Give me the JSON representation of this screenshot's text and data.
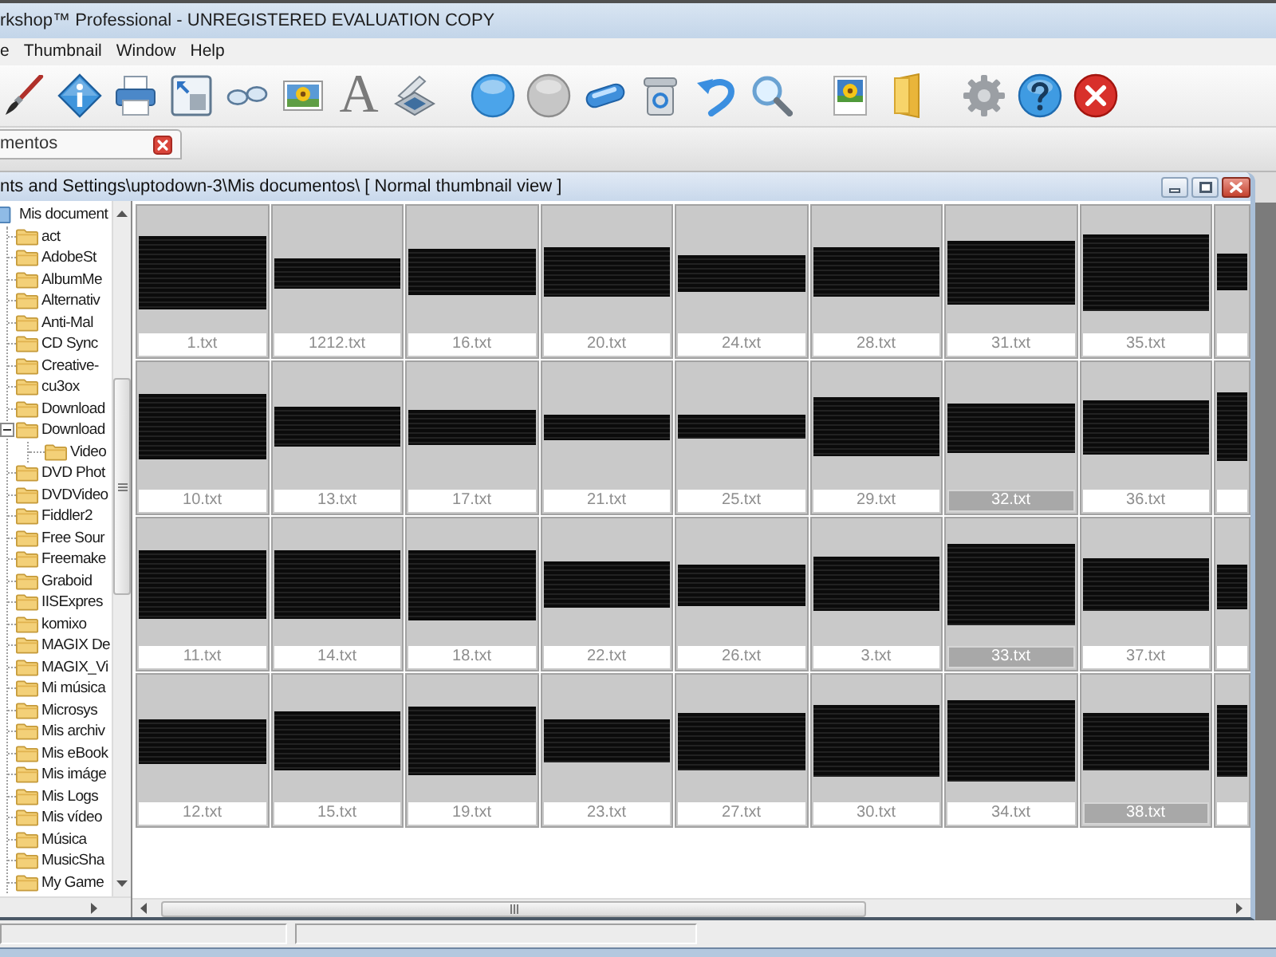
{
  "window": {
    "title": "rkshop™ Professional - UNREGISTERED EVALUATION COPY"
  },
  "menu": [
    {
      "label": "e"
    },
    {
      "label": "Thumbnail"
    },
    {
      "label": "Window"
    },
    {
      "label": "Help"
    }
  ],
  "toolbar": {
    "groups": [
      {
        "items": [
          {
            "kind": "brush"
          },
          {
            "kind": "info"
          },
          {
            "kind": "printer"
          },
          {
            "kind": "resize"
          },
          {
            "kind": "glasses"
          },
          {
            "kind": "photo"
          },
          {
            "kind": "text",
            "label": "A"
          },
          {
            "kind": "scanner"
          }
        ]
      },
      {
        "items": [
          {
            "kind": "ball"
          },
          {
            "kind": "ballgray"
          },
          {
            "kind": "capsule"
          },
          {
            "kind": "trash"
          },
          {
            "kind": "undo"
          },
          {
            "kind": "search"
          }
        ]
      },
      {
        "items": [
          {
            "kind": "picture"
          },
          {
            "kind": "folder"
          }
        ]
      },
      {
        "items": [
          {
            "kind": "settings"
          },
          {
            "kind": "help"
          },
          {
            "kind": "exit"
          }
        ]
      }
    ]
  },
  "tabs": [
    {
      "label": "mentos",
      "selected": true
    }
  ],
  "document_window": {
    "title": "nts and Settings\\uptodown-3\\Mis documentos\\ [ Normal thumbnail view ]",
    "folder_tree": {
      "items": [
        {
          "label": "Mis document",
          "children": [
            {
              "label": "act"
            },
            {
              "label": "AdobeSt"
            },
            {
              "label": "AlbumMe"
            },
            {
              "label": "Alternativ"
            },
            {
              "label": "Anti-Mal"
            },
            {
              "label": "CD Sync"
            },
            {
              "label": "Creative-"
            },
            {
              "label": "cu3ox"
            },
            {
              "label": "Download"
            },
            {
              "label": "Download",
              "expanded": true,
              "children": [
                {
                  "label": "Video"
                }
              ]
            },
            {
              "label": "DVD Phot"
            },
            {
              "label": "DVDVideo"
            },
            {
              "label": "Fiddler2"
            },
            {
              "label": "Free Sour"
            },
            {
              "label": "Freemake"
            },
            {
              "label": "Graboid"
            },
            {
              "label": "IISExpres"
            },
            {
              "label": "komixo"
            },
            {
              "label": "MAGIX De"
            },
            {
              "label": "MAGIX_Vi"
            },
            {
              "label": "Mi música"
            },
            {
              "label": "Microsys"
            },
            {
              "label": "Mis archiv"
            },
            {
              "label": "Mis eBook"
            },
            {
              "label": "Mis imáge"
            },
            {
              "label": "Mis Logs"
            },
            {
              "label": "Mis vídeo"
            },
            {
              "label": "Música"
            },
            {
              "label": "MusicSha"
            },
            {
              "label": "My Game"
            }
          ]
        }
      ]
    },
    "thumbnails": [
      {
        "name": "1.txt",
        "selected": false
      },
      {
        "name": "1212.txt",
        "selected": false
      },
      {
        "name": "16.txt",
        "selected": false
      },
      {
        "name": "20.txt",
        "selected": false
      },
      {
        "name": "24.txt",
        "selected": false
      },
      {
        "name": "28.txt",
        "selected": false
      },
      {
        "name": "31.txt",
        "selected": false
      },
      {
        "name": "35.txt",
        "selected": false
      },
      {
        "selected": false
      },
      {
        "name": "10.txt",
        "selected": false
      },
      {
        "name": "13.txt",
        "selected": false
      },
      {
        "name": "17.txt",
        "selected": false
      },
      {
        "name": "21.txt",
        "selected": false
      },
      {
        "name": "25.txt",
        "selected": false
      },
      {
        "name": "29.txt",
        "selected": false
      },
      {
        "name": "32.txt",
        "selected": true
      },
      {
        "name": "36.txt",
        "selected": false
      },
      {
        "selected": false
      },
      {
        "name": "11.txt",
        "selected": false
      },
      {
        "name": "14.txt",
        "selected": false
      },
      {
        "name": "18.txt",
        "selected": false
      },
      {
        "name": "22.txt",
        "selected": false
      },
      {
        "name": "26.txt",
        "selected": false
      },
      {
        "name": "3.txt",
        "selected": false
      },
      {
        "name": "33.txt",
        "selected": true
      },
      {
        "name": "37.txt",
        "selected": false
      },
      {
        "selected": false
      },
      {
        "name": "12.txt",
        "selected": false
      },
      {
        "name": "15.txt",
        "selected": false
      },
      {
        "name": "19.txt",
        "selected": false
      },
      {
        "name": "23.txt",
        "selected": false
      },
      {
        "name": "27.txt",
        "selected": false
      },
      {
        "name": "30.txt",
        "selected": false
      },
      {
        "name": "34.txt",
        "selected": false
      },
      {
        "name": "38.txt",
        "selected": true
      },
      {
        "selected": false
      }
    ]
  }
}
